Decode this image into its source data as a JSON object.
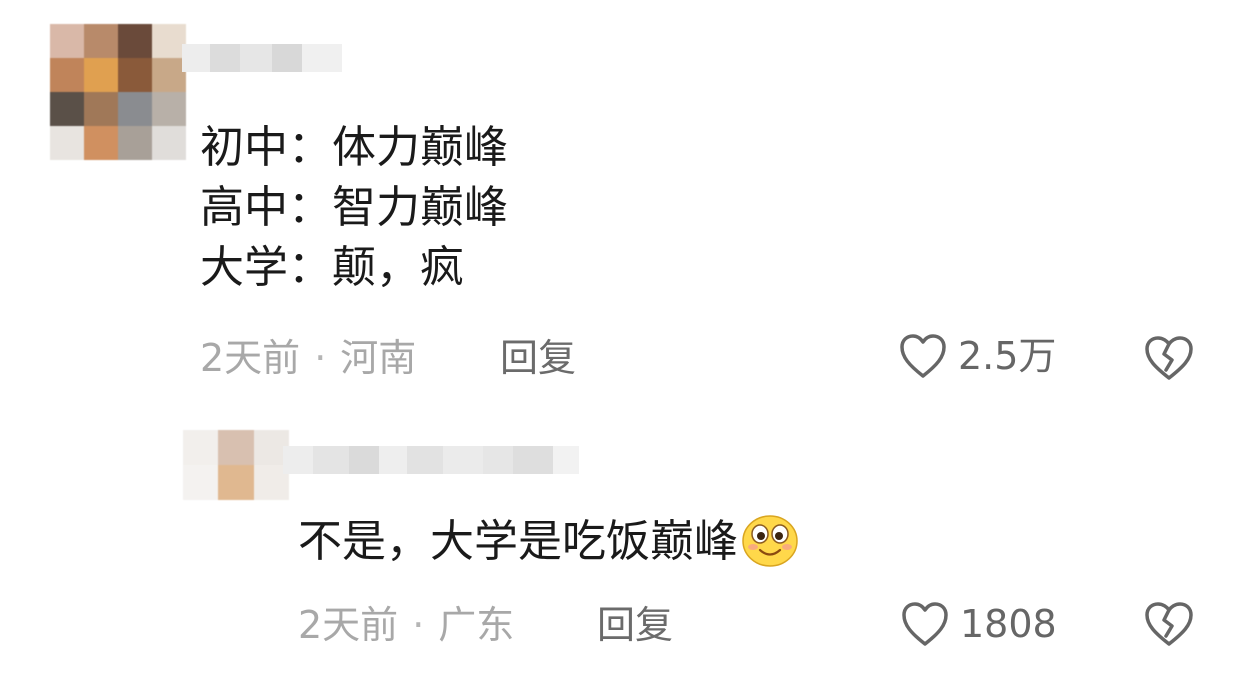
{
  "comments": [
    {
      "lines": [
        "初中：体力巅峰",
        "高中：智力巅峰",
        "大学：颠，疯"
      ],
      "time": "2天前",
      "location": "河南",
      "reply_label": "回复",
      "likes": "2.5万"
    },
    {
      "text": "不是，大学是吃饭巅峰",
      "emoji": "smile-emoji-icon",
      "time": "2天前",
      "location": "广东",
      "reply_label": "回复",
      "likes": "1808"
    }
  ],
  "colors": {
    "text": "#1a1a1a",
    "meta": "#a8a8a8",
    "icon": "#666666"
  }
}
